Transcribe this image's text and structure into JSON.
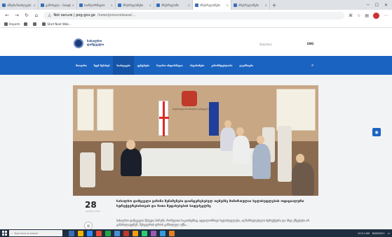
{
  "browser": {
    "tabs": [
      {
        "title": "ამბები/სიახლეები"
      },
      {
        "title": "გამოსვლა - Google"
      },
      {
        "title": "საინფორმაციო"
      },
      {
        "title": "პრესრელიზები"
      },
      {
        "title": "პრესრელიზი"
      },
      {
        "title": "პრესრელიზები",
        "active": true
      },
      {
        "title": "პრესრელიზები"
      }
    ],
    "url_host": "Not secure | pog.gov.ge",
    "url_path": "/news/pressrelease/...",
    "bookmarks": [
      {
        "label": "Imports"
      },
      {
        "label": ""
      },
      {
        "label": ""
      },
      {
        "label": "Start Next Web..."
      }
    ]
  },
  "site": {
    "logo_text": "სახალხო დამცველი",
    "header_links": "Skiplinks",
    "lang": "ENG",
    "nav": [
      {
        "label": "მთავარი"
      },
      {
        "label": "ჩვენ შესახებ"
      },
      {
        "label": "სიახლეები",
        "active": true
      },
      {
        "label": "ცენტრები"
      },
      {
        "label": "საჯარო ინფორმაცია"
      },
      {
        "label": "ანგარიშები"
      },
      {
        "label": "კანონმდებლობა"
      },
      {
        "label": "ვაკანსიები"
      }
    ]
  },
  "article": {
    "photo_caption": "საქართველოს სახალხო დამცველი",
    "day": "28",
    "month": "აგვისტო 2021",
    "title": "სახალხო დამცველი ყაზანი შენიშვნები დაინტერესებულ თემებზე მიმართულია ხელისუფლების ოფიციალური სტრუქტურებისთვის და მათი შეფასებების საფუძველზე",
    "body": "სახალხო დამცველი შეხვდა პირებს, რომელთა საკითხებსაც ადგილობრივი ხელისუფლება, აღმასრულებელი სტრუქტურა და სხვა უწყებები არ განიხილავდნენ. შეხვედრის დროს განხილულ იქნა..."
  },
  "taskbar": {
    "search_placeholder": "Type here to search",
    "time": "10:11 AM",
    "date": "8/28/2021",
    "apps": [
      "#3a6fb8",
      "#f2b300",
      "#2d8cff",
      "#e94b35",
      "#27a745",
      "#4a90d9",
      "#c0392b",
      "#f39c12",
      "#2ecc71",
      "#9b59b6",
      "#3498db",
      "#e67e22"
    ]
  }
}
